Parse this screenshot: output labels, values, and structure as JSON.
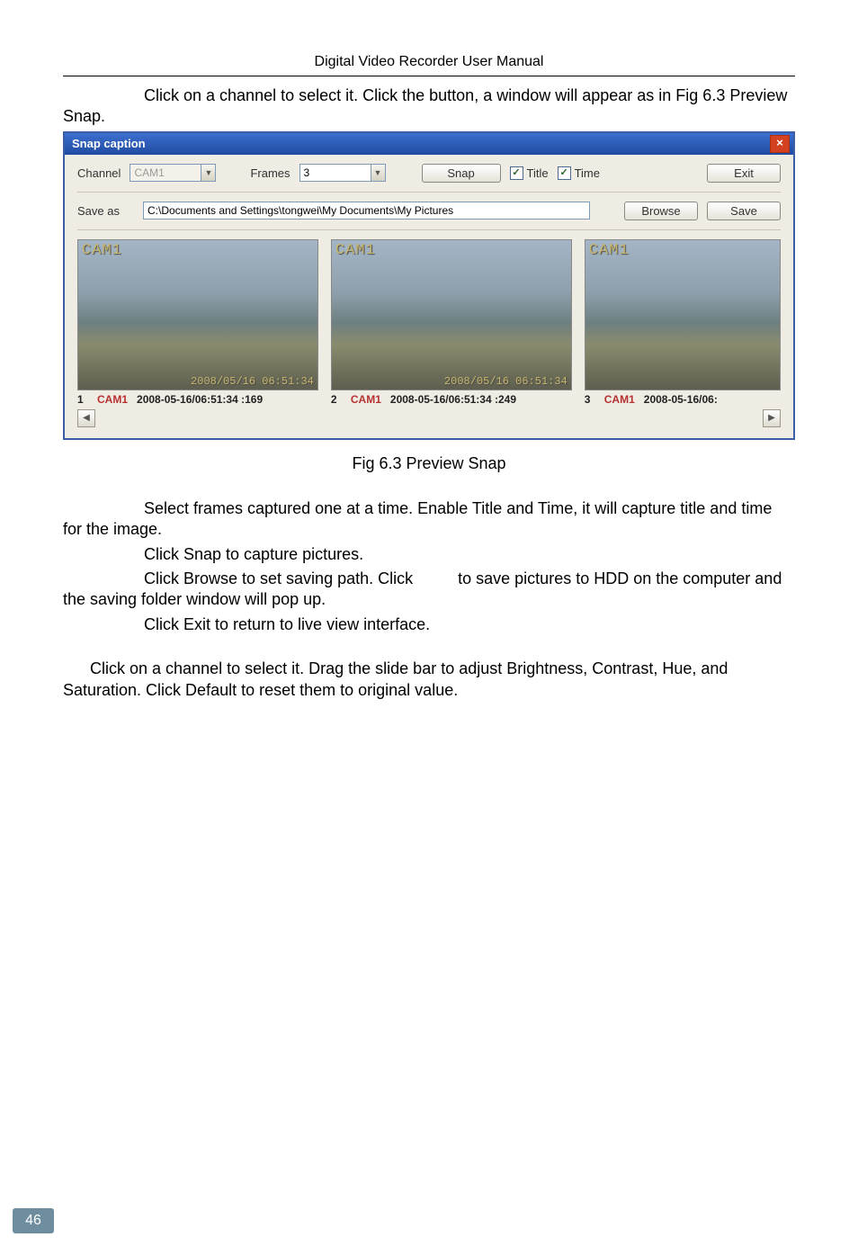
{
  "doc": {
    "header": "Digital Video Recorder User Manual",
    "page_number": "46",
    "para_intro_1": "Click on a channel to select it. Click the button, a window will appear as in Fig 6.3 Preview Snap.",
    "fig_caption": "Fig 6.3 Preview Snap",
    "para2": "Select frames captured one at a time. Enable Title and Time, it will capture title and time for the image.",
    "para3": "Click Snap to capture pictures.",
    "para4a": "Click Browse to set saving path. Click ",
    "para4b": " to save pictures to HDD on the computer and the saving folder window will pop up.",
    "para5": "Click Exit to return to live view interface.",
    "para6": "Click on a channel to select it. Drag the slide bar to adjust Brightness, Contrast, Hue, and Saturation. Click Default to reset them to original value."
  },
  "dlg": {
    "title": "Snap caption",
    "channel_label": "Channel",
    "channel_value": "CAM1",
    "frames_label": "Frames",
    "frames_value": "3",
    "snap_btn": "Snap",
    "title_chk": "Title",
    "time_chk": "Time",
    "exit_btn": "Exit",
    "saveas_label": "Save as",
    "saveas_path": "C:\\Documents and Settings\\tongwei\\My Documents\\My Pictures",
    "browse_btn": "Browse",
    "save_btn": "Save",
    "thumbs": [
      {
        "idx": "1",
        "overlay_label": "CAM1",
        "overlay_ts": "2008/05/16 06:51:34",
        "cam_label": "CAM1",
        "ts_label": "2008-05-16/06:51:34 :169"
      },
      {
        "idx": "2",
        "overlay_label": "CAM1",
        "overlay_ts": "2008/05/16 06:51:34",
        "cam_label": "CAM1",
        "ts_label": "2008-05-16/06:51:34 :249"
      },
      {
        "idx": "3",
        "overlay_label": "CAM1",
        "overlay_ts": "",
        "cam_label": "CAM1",
        "ts_label": "2008-05-16/06:"
      }
    ]
  }
}
